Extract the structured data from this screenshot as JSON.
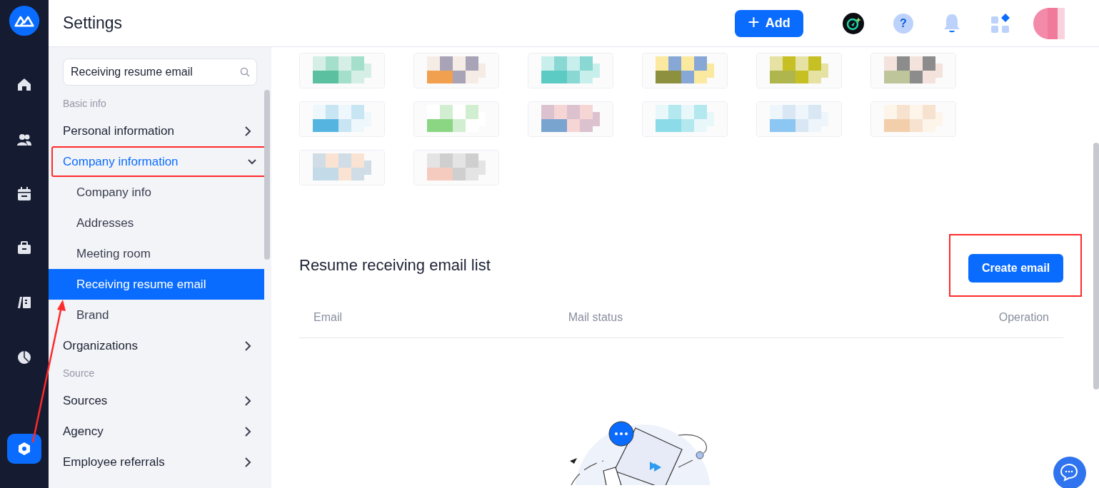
{
  "header": {
    "title": "Settings",
    "add_button": "Add",
    "add_icon": "+",
    "help_icon": "?"
  },
  "rail": [
    {
      "selected": false
    },
    {
      "selected": false
    },
    {
      "selected": false
    },
    {
      "selected": false
    },
    {
      "selected": false
    },
    {
      "selected": false
    },
    {
      "selected": true
    }
  ],
  "sidebar": {
    "search": {
      "value": "Receiving resume email"
    },
    "sections": [
      {
        "heading": "Basic info",
        "items": [
          {
            "label": "Personal information",
            "expanded": false,
            "highlighted": false
          },
          {
            "label": "Company information",
            "expanded": true,
            "highlighted": true,
            "children": [
              {
                "label": "Company info",
                "selected": false
              },
              {
                "label": "Addresses",
                "selected": false
              },
              {
                "label": "Meeting room",
                "selected": false
              },
              {
                "label": "Receiving resume email",
                "selected": true
              },
              {
                "label": "Brand",
                "selected": false
              }
            ]
          },
          {
            "label": "Organizations",
            "expanded": false,
            "highlighted": false
          }
        ]
      },
      {
        "heading": "Source",
        "items": [
          {
            "label": "Sources",
            "expanded": false,
            "highlighted": false
          },
          {
            "label": "Agency",
            "expanded": false,
            "highlighted": false
          },
          {
            "label": "Employee referrals",
            "expanded": false,
            "highlighted": false
          }
        ]
      }
    ]
  },
  "email_list": {
    "title": "Resume receiving email list",
    "create_button": {
      "label": "Create email",
      "highlighted": true
    },
    "columns": [
      "Email",
      "Mail status",
      "Operation"
    ]
  },
  "annotation_arrow": true
}
